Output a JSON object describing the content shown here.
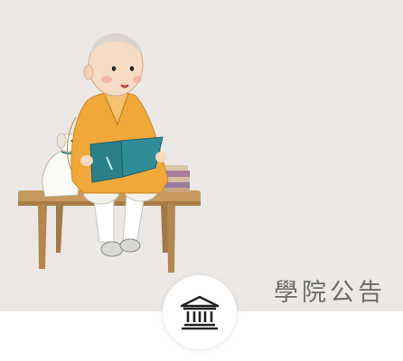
{
  "banner": {
    "title": "學院公告",
    "icon": "academy-building-icon",
    "illustration": "monk-reading-book-illustration"
  },
  "colors": {
    "banner_bg": "#ebe8e5",
    "robe": "#f0a83a",
    "book": "#2a7f8a",
    "bench": "#c69a5e"
  }
}
